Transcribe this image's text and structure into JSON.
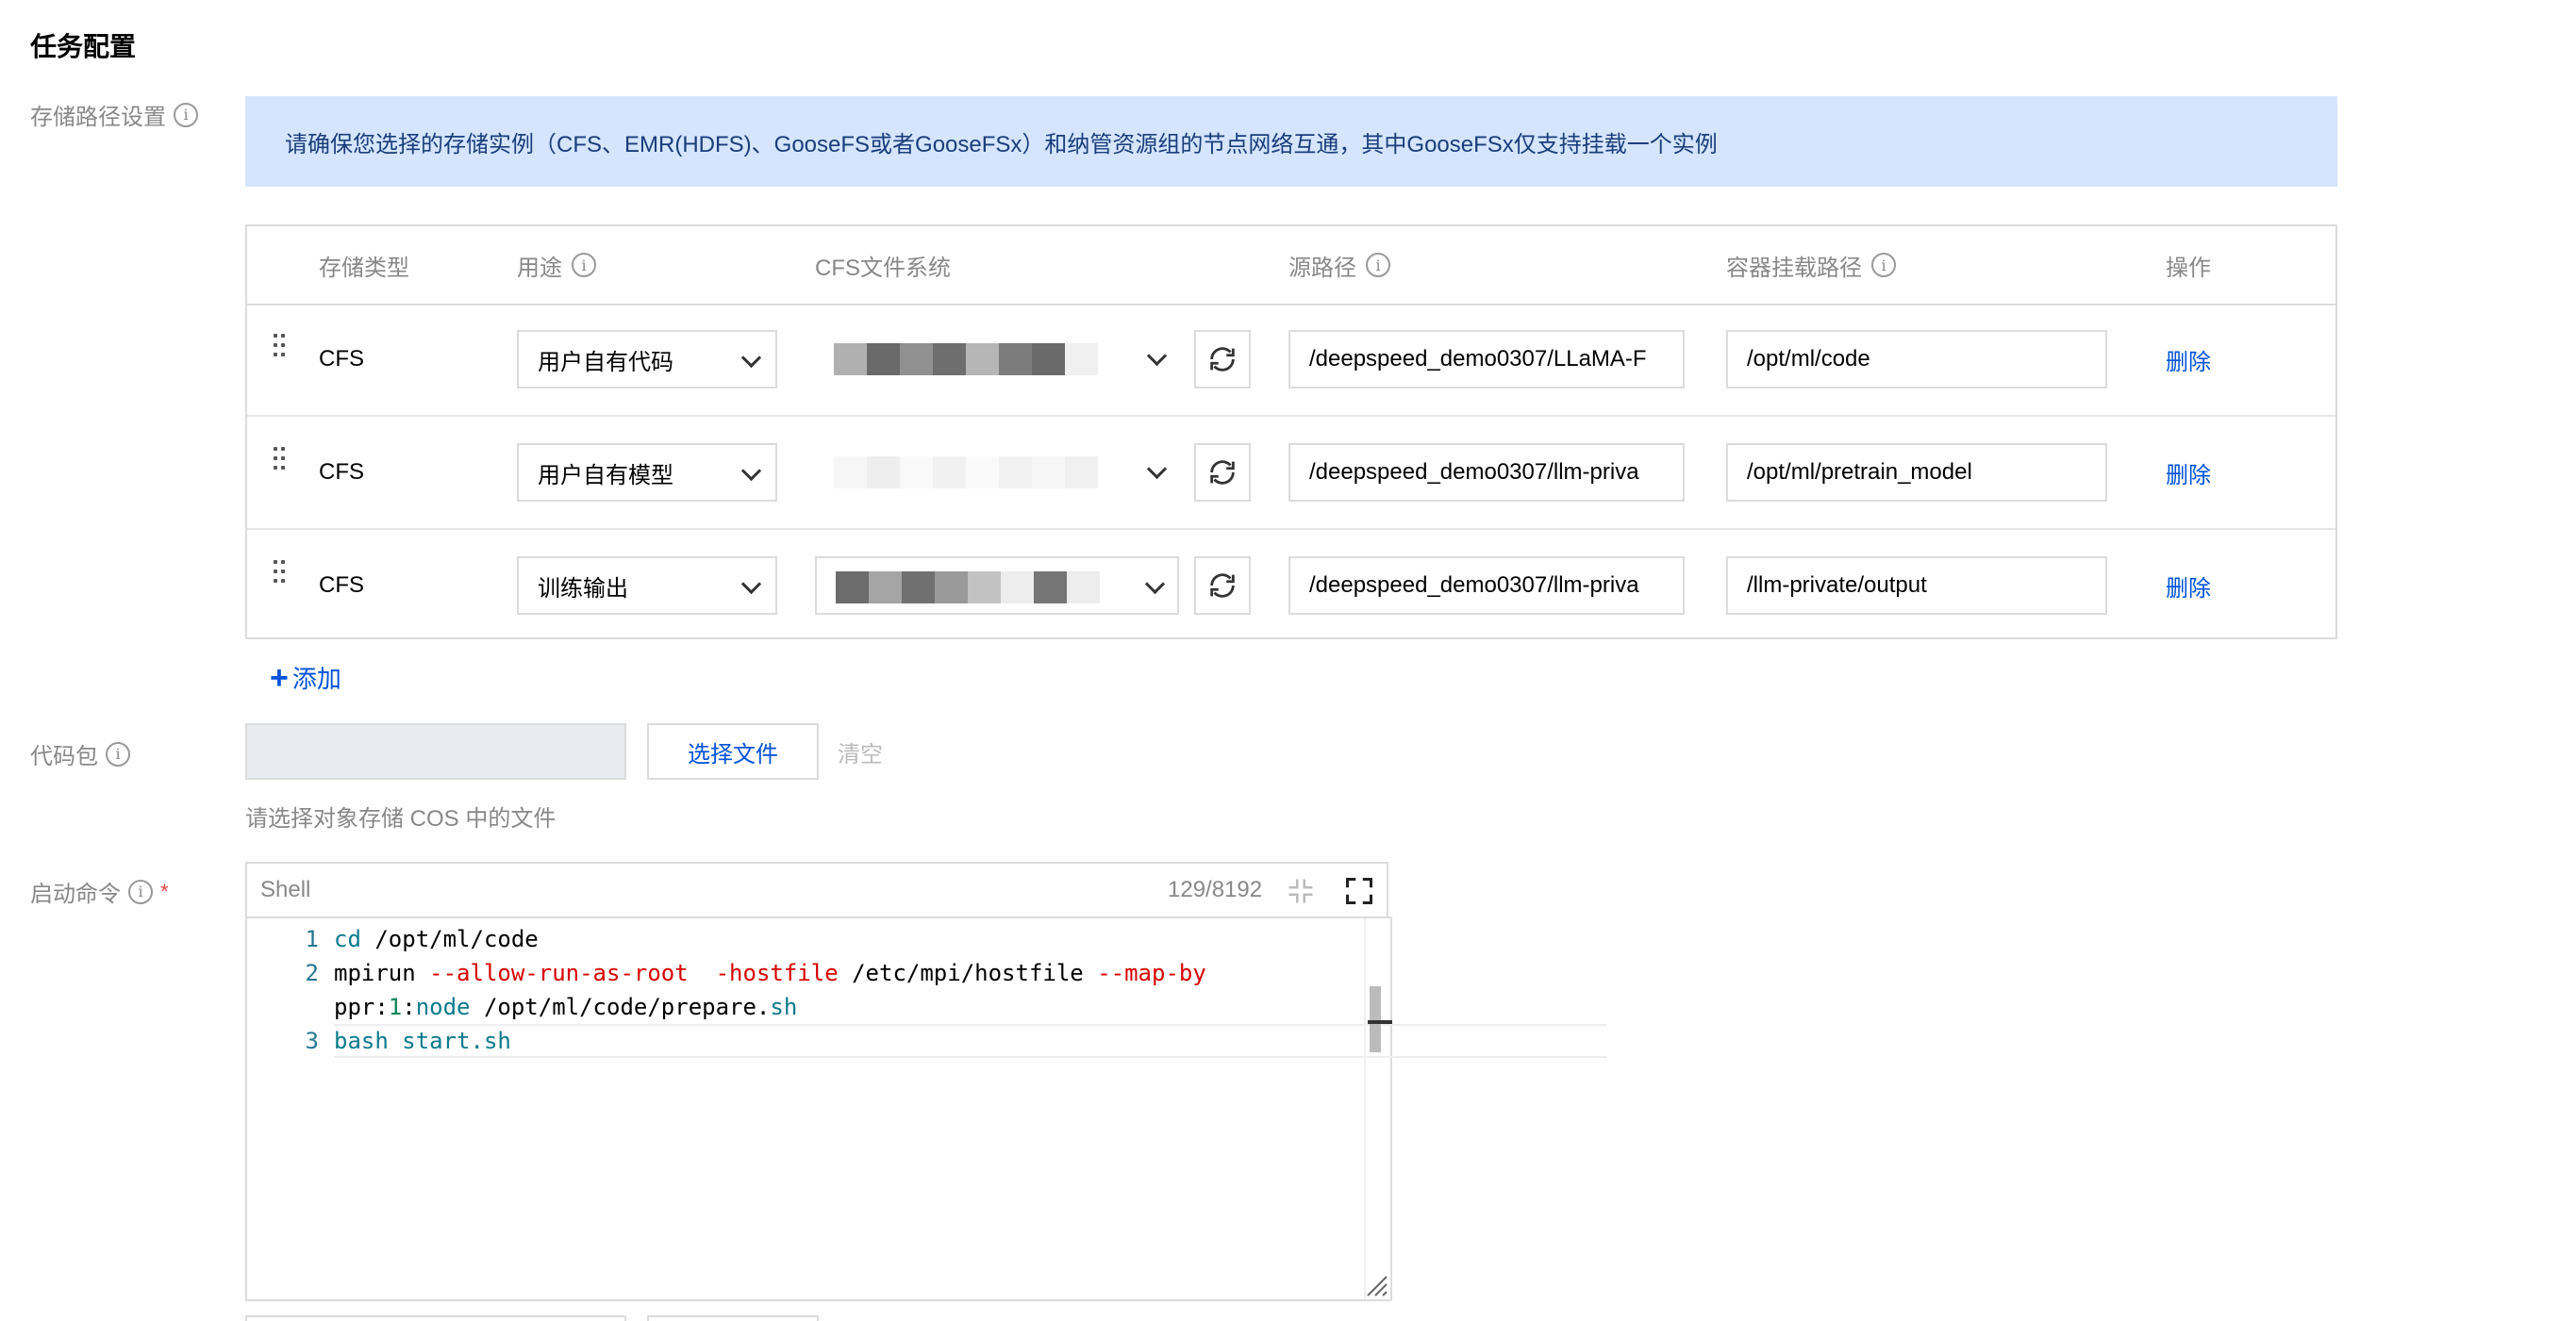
{
  "section_title": "任务配置",
  "storage": {
    "label": "存储路径设置",
    "notice": "请确保您选择的存储实例（CFS、EMR(HDFS)、GooseFS或者GooseFSx）和纳管资源组的节点网络互通，其中GooseFSx仅支持挂载一个实例",
    "columns": {
      "type": "存储类型",
      "usage": "用途",
      "filesystem": "CFS文件系统",
      "source_path": "源路径",
      "mount_path": "容器挂载路径",
      "action": "操作"
    },
    "rows": [
      {
        "type": "CFS",
        "usage": "用户自有代码",
        "source_path": "/deepspeed_demo0307/LLaMA-F",
        "mount_path": "/opt/ml/code",
        "action": "删除"
      },
      {
        "type": "CFS",
        "usage": "用户自有模型",
        "source_path": "/deepspeed_demo0307/llm-priva",
        "mount_path": "/opt/ml/pretrain_model",
        "action": "删除"
      },
      {
        "type": "CFS",
        "usage": "训练输出",
        "source_path": "/deepspeed_demo0307/llm-priva",
        "mount_path": "/llm-private/output",
        "action": "删除"
      }
    ],
    "add_label": "添加"
  },
  "code_package": {
    "label": "代码包",
    "select_button": "选择文件",
    "clear_button": "清空",
    "hint": "请选择对象存储 COS 中的文件"
  },
  "start_command": {
    "label": "启动命令",
    "required_mark": "*",
    "language": "Shell",
    "char_count": "129/8192",
    "lines": [
      {
        "num": "1",
        "parts": [
          {
            "t": "cd",
            "c": "teal"
          },
          {
            "t": " /opt/ml/code",
            "c": ""
          }
        ]
      },
      {
        "num": "2",
        "parts": [
          {
            "t": "mpirun ",
            "c": ""
          },
          {
            "t": "--allow-run-as-root",
            "c": "kw"
          },
          {
            "t": "  ",
            "c": ""
          },
          {
            "t": "-hostfile",
            "c": "kw"
          },
          {
            "t": " /etc/mpi/hostfile ",
            "c": ""
          },
          {
            "t": "--map-by",
            "c": "kw"
          }
        ]
      },
      {
        "num": "",
        "parts": [
          {
            "t": "ppr:",
            "c": ""
          },
          {
            "t": "1",
            "c": "tl"
          },
          {
            "t": ":",
            "c": ""
          },
          {
            "t": "node",
            "c": "teal"
          },
          {
            "t": " /opt/ml/code/prepare.",
            "c": ""
          },
          {
            "t": "sh",
            "c": "teal"
          }
        ]
      },
      {
        "num": "3",
        "parts": [
          {
            "t": "bash start.sh",
            "c": "teal"
          }
        ]
      }
    ]
  },
  "colors": {
    "accent": "#0052d9",
    "notice_bg": "#d5e5fd",
    "required": "#e54545"
  }
}
